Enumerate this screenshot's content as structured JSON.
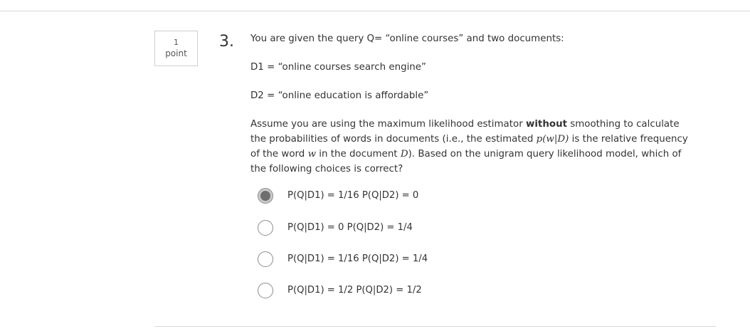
{
  "question": {
    "points_value": "1",
    "points_unit": "point",
    "number": "3.",
    "intro": "You are given the query Q= “online courses” and two documents:",
    "d1": "D1 = “online courses search engine”",
    "d2": "D2 = “online education is affordable”",
    "assume_part1": "Assume you are using the maximum likelihood estimator ",
    "assume_bold": "without",
    "assume_part2": " smoothing to calculate the probabilities of words in documents (i.e., the estimated ",
    "assume_math1": "p(w|D)",
    "assume_part3": " is the relative frequency of the word ",
    "assume_math2": "w",
    "assume_part4": " in the document ",
    "assume_math3": "D",
    "assume_part5": "). Based on the unigram query likelihood model, which of the following choices is correct?"
  },
  "options": [
    {
      "label": "P(Q|D1) = 1/16 P(Q|D2) = 0",
      "selected": true
    },
    {
      "label": "P(Q|D1) = 0 P(Q|D2) = 1/4",
      "selected": false
    },
    {
      "label": "P(Q|D1) = 1/16 P(Q|D2) = 1/4",
      "selected": false
    },
    {
      "label": "P(Q|D1) = 1/2 P(Q|D2) = 1/2",
      "selected": false
    }
  ]
}
